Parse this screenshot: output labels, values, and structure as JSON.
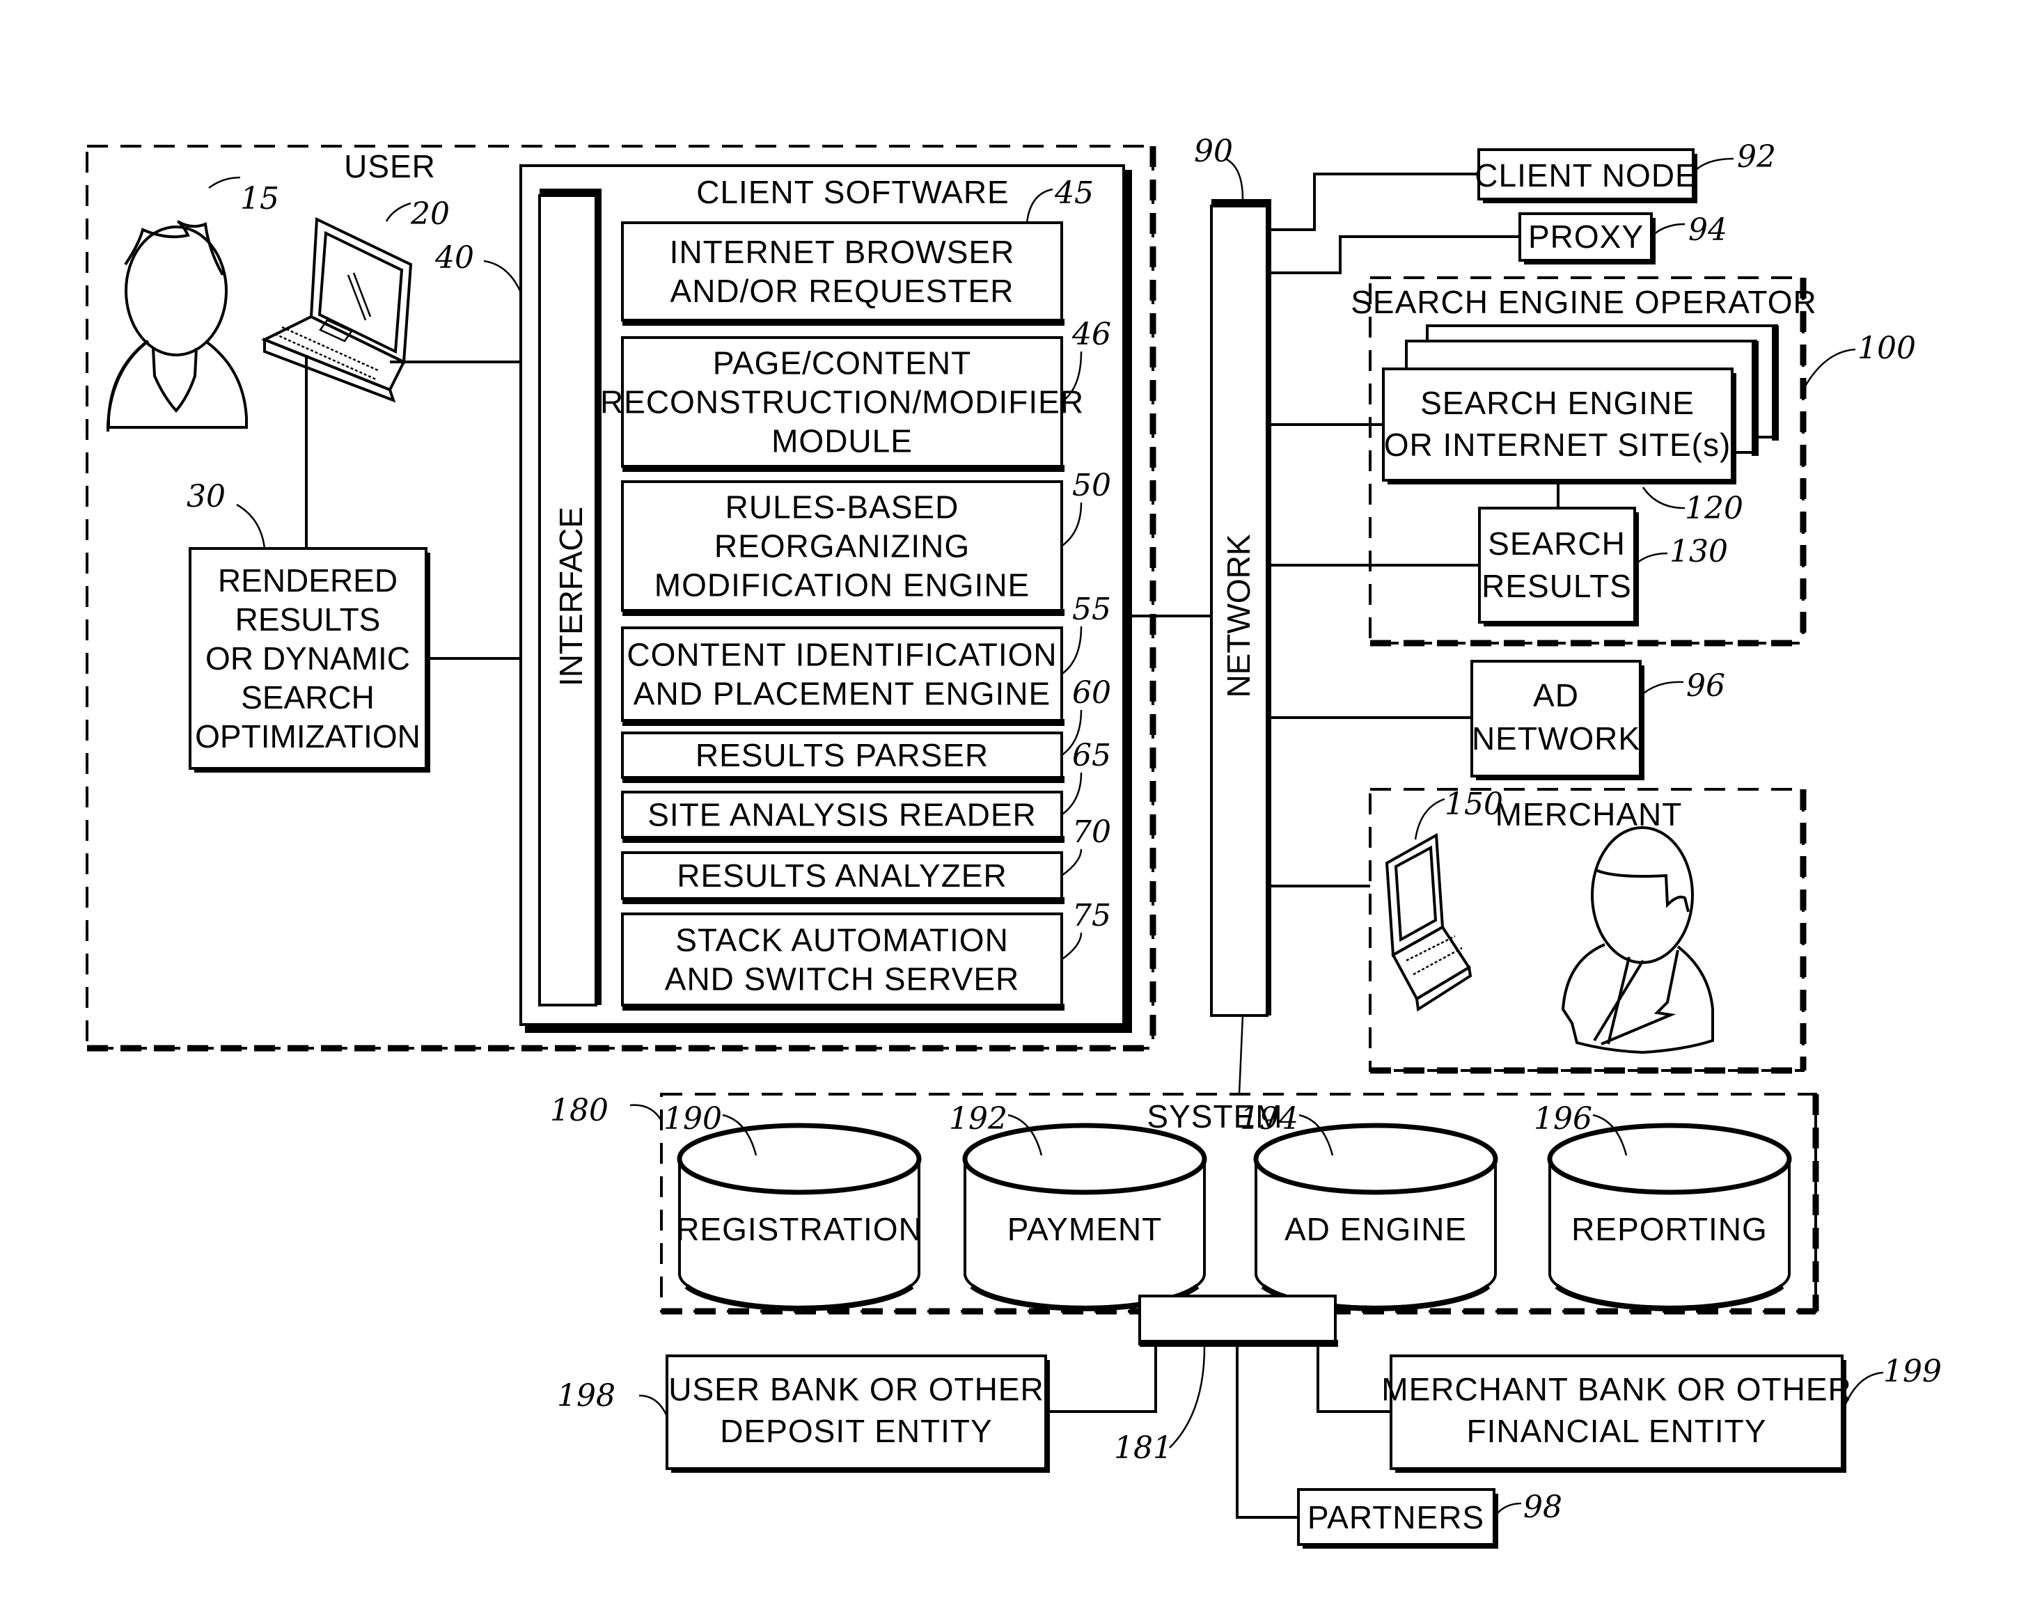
{
  "figure": {
    "user_group": {
      "title": "USER",
      "ref_user": "15",
      "ref_laptop": "20",
      "ref_interface_link": "40",
      "rendered_results": {
        "ref": "30",
        "lines": [
          "RENDERED",
          "RESULTS",
          "OR DYNAMIC",
          "SEARCH",
          "OPTIMIZATION"
        ]
      },
      "client_software": {
        "title": "CLIENT SOFTWARE",
        "interface_label": "INTERFACE",
        "modules": [
          {
            "ref": "45",
            "lines": [
              "INTERNET BROWSER",
              "AND/OR REQUESTER"
            ]
          },
          {
            "ref": "46",
            "lines": [
              "PAGE/CONTENT",
              "RECONSTRUCTION/MODIFIER",
              "MODULE"
            ]
          },
          {
            "ref": "50",
            "lines": [
              "RULES-BASED",
              "REORGANIZING",
              "MODIFICATION ENGINE"
            ]
          },
          {
            "ref": "55",
            "lines": [
              "CONTENT IDENTIFICATION",
              "AND PLACEMENT ENGINE"
            ]
          },
          {
            "ref": "60",
            "lines": [
              "RESULTS PARSER"
            ]
          },
          {
            "ref": "65",
            "lines": [
              "SITE ANALYSIS READER"
            ]
          },
          {
            "ref": "70",
            "lines": [
              "RESULTS ANALYZER"
            ]
          },
          {
            "ref": "75",
            "lines": [
              "STACK AUTOMATION",
              "AND SWITCH SERVER"
            ]
          }
        ]
      }
    },
    "network": {
      "label": "NETWORK",
      "ref": "90"
    },
    "client_node": {
      "label": "CLIENT NODE",
      "ref": "92"
    },
    "proxy": {
      "label": "PROXY",
      "ref": "94"
    },
    "search_engine_operator": {
      "title": "SEARCH ENGINE OPERATOR",
      "ref": "100",
      "search_engine": {
        "lines": [
          "SEARCH ENGINE",
          "OR INTERNET SITE(s)"
        ],
        "ref": "120"
      },
      "search_results": {
        "lines": [
          "SEARCH",
          "RESULTS"
        ],
        "ref": "130"
      }
    },
    "ad_network": {
      "lines": [
        "AD",
        "NETWORK"
      ],
      "ref": "96"
    },
    "merchant": {
      "title": "MERCHANT",
      "ref_laptop": "150"
    },
    "system": {
      "title": "SYSTEM",
      "ref": "180",
      "databases": [
        {
          "label": "REGISTRATION",
          "ref": "190"
        },
        {
          "label": "PAYMENT",
          "ref": "192"
        },
        {
          "label": "AD ENGINE",
          "ref": "194"
        },
        {
          "label": "REPORTING",
          "ref": "196"
        }
      ],
      "connector_ref": "181"
    },
    "user_bank": {
      "lines": [
        "USER BANK OR OTHER",
        "DEPOSIT ENTITY"
      ],
      "ref": "198"
    },
    "merchant_bank": {
      "lines": [
        "MERCHANT BANK OR OTHER",
        "FINANCIAL ENTITY"
      ],
      "ref": "199"
    },
    "partners": {
      "label": "PARTNERS",
      "ref": "98"
    }
  }
}
